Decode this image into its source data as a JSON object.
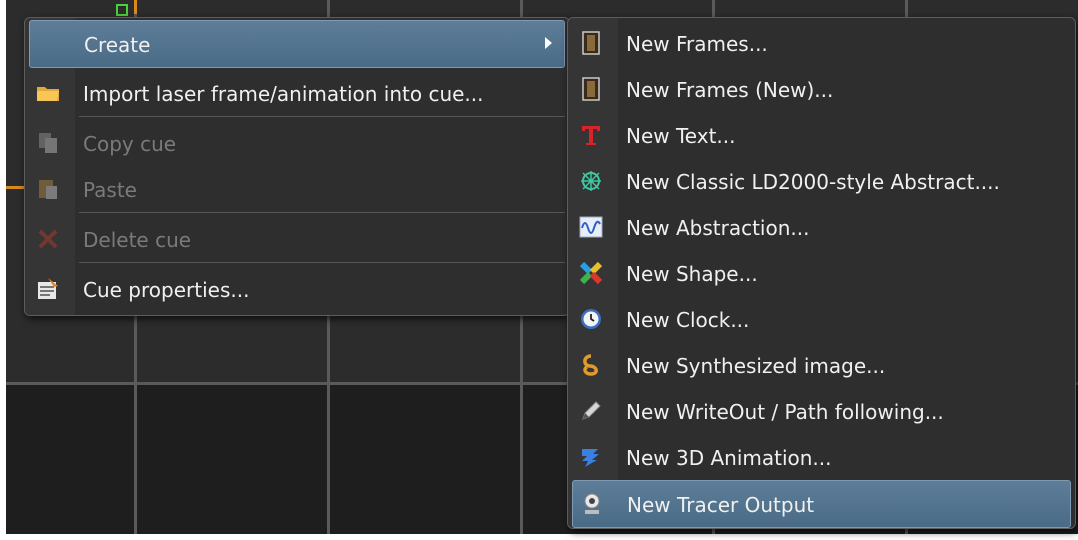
{
  "main_menu": {
    "items": [
      {
        "label": "Create",
        "icon": "create-icon",
        "enabled": true,
        "has_submenu": true,
        "highlighted": true
      },
      {
        "label": "Import laser frame/animation into cue...",
        "icon": "folder-icon",
        "enabled": true
      },
      {
        "label": "Copy cue",
        "icon": "copy-icon",
        "enabled": false
      },
      {
        "label": "Paste",
        "icon": "paste-icon",
        "enabled": false
      },
      {
        "label": "Delete cue",
        "icon": "delete-icon",
        "enabled": false
      },
      {
        "label": "Cue properties...",
        "icon": "properties-icon",
        "enabled": true
      }
    ]
  },
  "submenu": {
    "items": [
      {
        "label": "New Frames...",
        "icon": "film-icon"
      },
      {
        "label": "New Frames (New)...",
        "icon": "film-icon"
      },
      {
        "label": "New Text...",
        "icon": "text-icon"
      },
      {
        "label": "New Classic LD2000-style Abstract....",
        "icon": "abstract-classic-icon"
      },
      {
        "label": "New Abstraction...",
        "icon": "waveform-icon"
      },
      {
        "label": "New Shape...",
        "icon": "shape-icon"
      },
      {
        "label": "New Clock...",
        "icon": "clock-icon"
      },
      {
        "label": "New Synthesized image...",
        "icon": "synth-icon"
      },
      {
        "label": "New WriteOut / Path following...",
        "icon": "pen-icon"
      },
      {
        "label": "New 3D Animation...",
        "icon": "3d-icon"
      },
      {
        "label": "New Tracer Output",
        "icon": "webcam-icon",
        "highlighted": true
      }
    ]
  },
  "colors": {
    "highlight": "#5d7d99",
    "menu_bg": "#2e2e2e",
    "disabled_text": "#7a7a7a"
  }
}
